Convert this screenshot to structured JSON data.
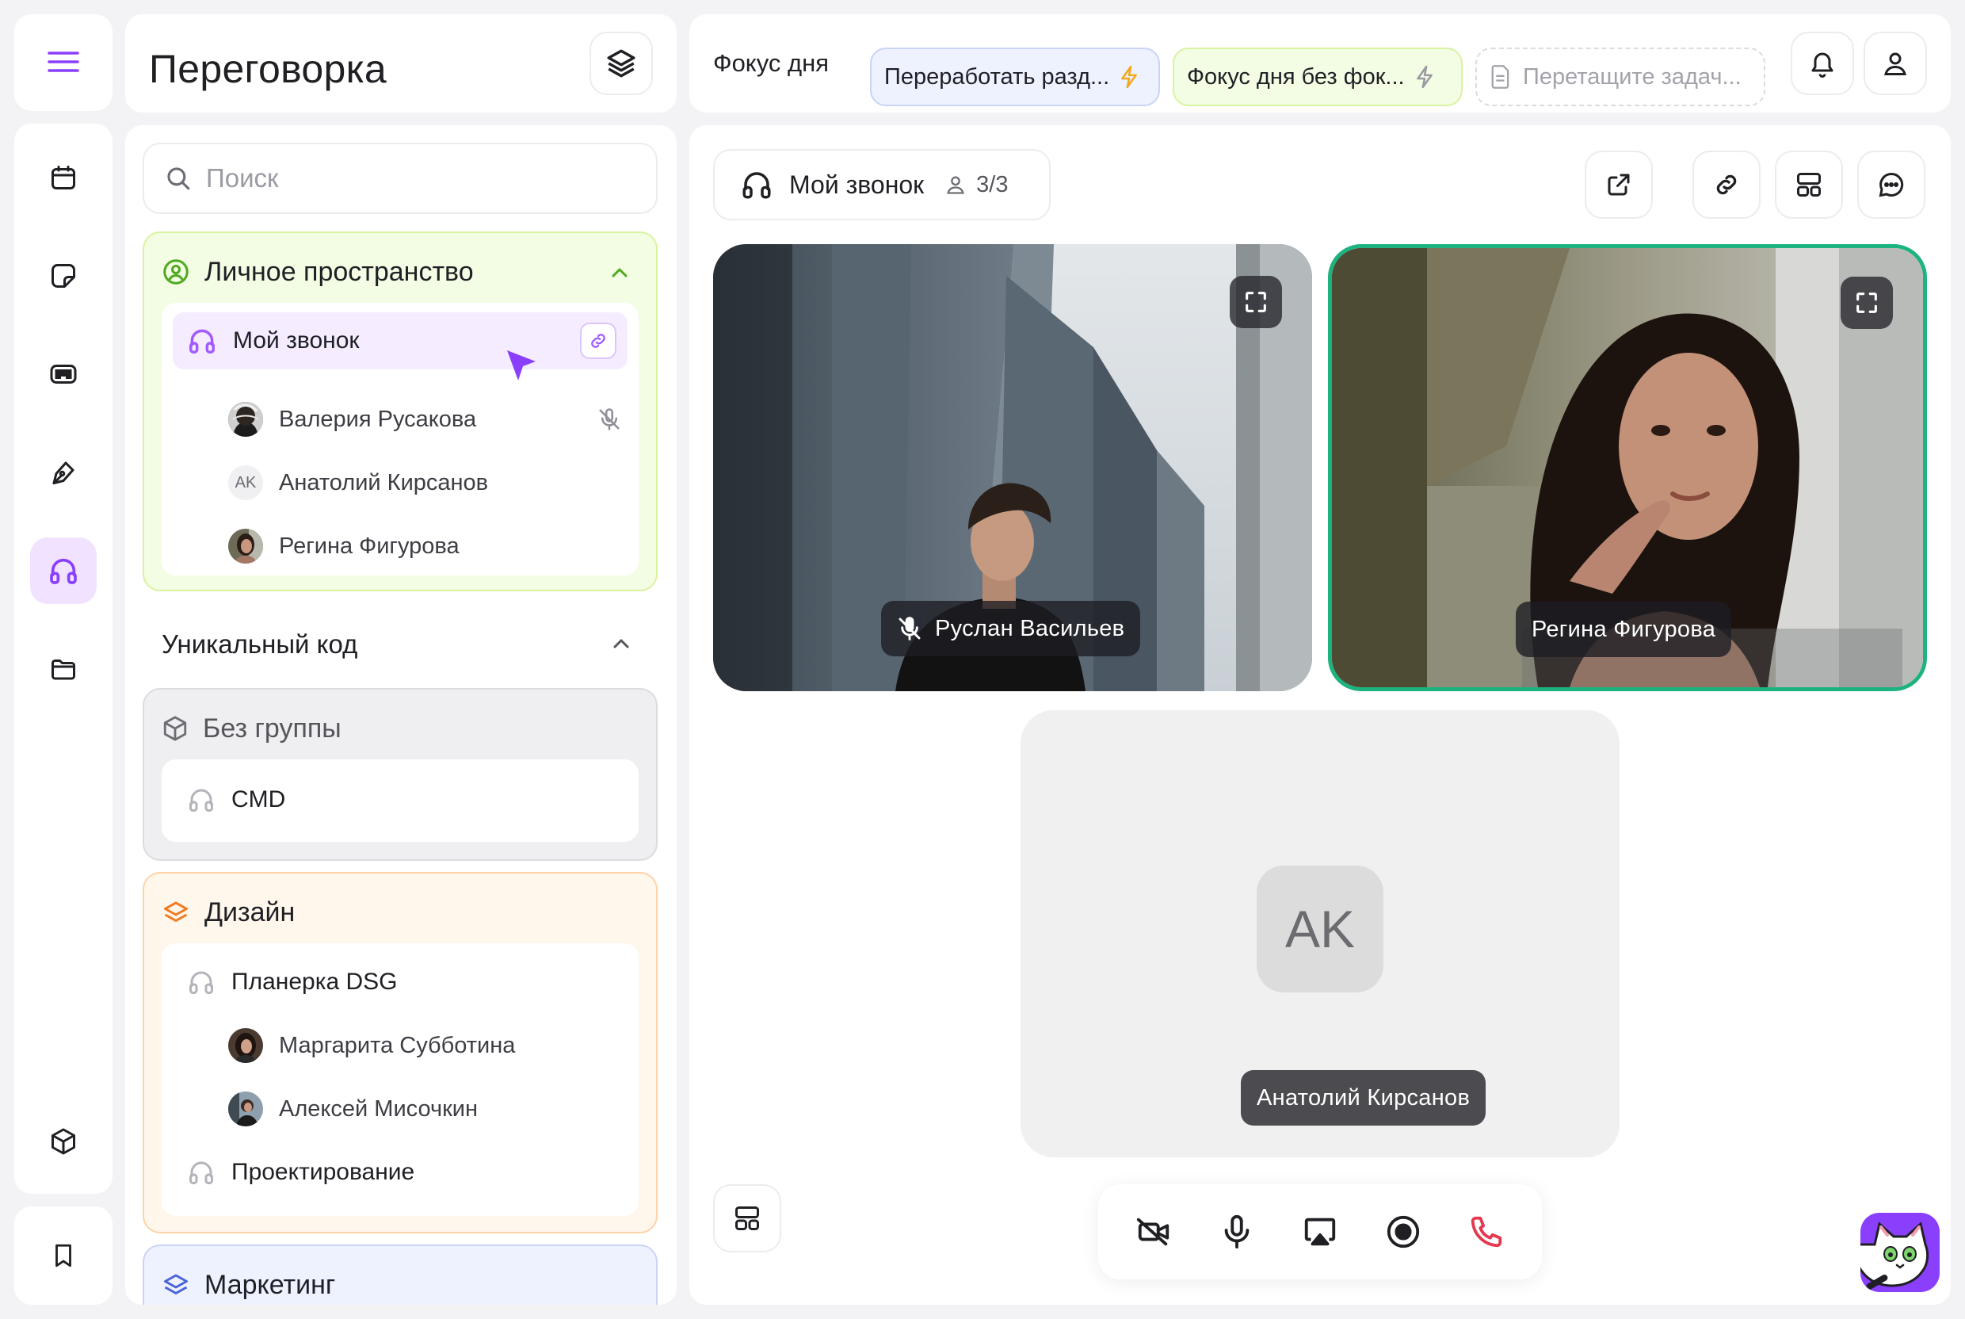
{
  "app": {
    "title": "Переговорка"
  },
  "rail": {
    "icons": [
      "calendar-icon",
      "note-icon",
      "dashboard-icon",
      "pen-icon",
      "headphones-icon",
      "folder-icon",
      "cube-icon",
      "bookmark-icon"
    ],
    "active": "headphones-icon"
  },
  "topbar": {
    "focus_label": "Фокус дня",
    "chips": [
      {
        "label": "Переработать разд...",
        "style": "blue"
      },
      {
        "label": "Фокус дня без фок...",
        "style": "green"
      }
    ],
    "drop_placeholder": "Перетащите задач..."
  },
  "sidebar": {
    "search_placeholder": "Поиск",
    "personal": {
      "title": "Личное пространство",
      "room": "Мой звонок",
      "members": [
        {
          "name": "Валерия Русакова",
          "muted": true
        },
        {
          "name": "Анатолий Кирсанов",
          "initials": "AK"
        },
        {
          "name": "Регина Фигурова"
        }
      ]
    },
    "unique_code": {
      "title": "Уникальный код"
    },
    "no_group": {
      "title": "Без группы",
      "rooms": [
        "CMD"
      ]
    },
    "design": {
      "title": "Дизайн",
      "rooms": [
        {
          "name": "Планерка DSG",
          "members": [
            "Маргарита Субботина",
            "Алексей Мисочкин"
          ]
        },
        {
          "name": "Проектирование"
        }
      ]
    },
    "marketing": {
      "title": "Маркетинг"
    }
  },
  "call": {
    "title": "Мой звонок",
    "participants_count": "3/3",
    "tiles": [
      {
        "name": "Руслан Васильев",
        "muted": true
      },
      {
        "name": "Регина Фигурова",
        "speaking": true
      },
      {
        "name": "Анатолий Кирсанов",
        "initials": "AK"
      }
    ],
    "controls": [
      "camera-off-icon",
      "microphone-icon",
      "screen-share-icon",
      "record-icon",
      "hang-up-icon"
    ]
  },
  "colors": {
    "accent_purple": "#8a3ffc",
    "personal_green": "#d8f3a0",
    "design_orange": "#ffd3a6",
    "marketing_blue": "#c9d4f7",
    "speaking_border": "#1db37e",
    "hangup_red": "#e53950"
  }
}
